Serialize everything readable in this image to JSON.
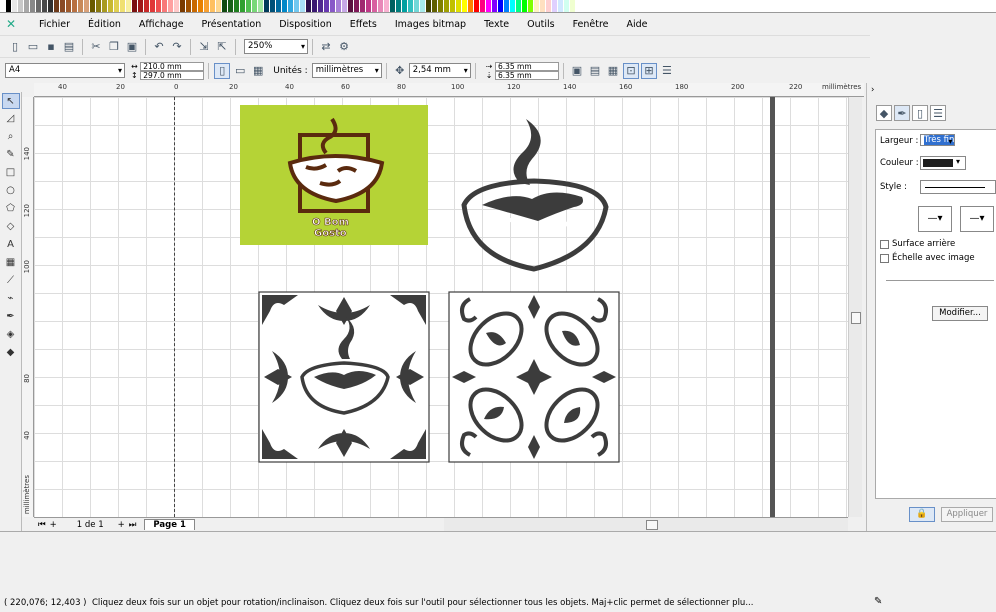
{
  "palette": [
    "#ffffff",
    "#000000",
    "#e8e8e8",
    "#c8c8c8",
    "#a8a8a8",
    "#888888",
    "#686868",
    "#484848",
    "#303030",
    "#6d3a1a",
    "#8a4a25",
    "#a05a2c",
    "#b87040",
    "#c88a5a",
    "#d8a078",
    "#6a5a00",
    "#8a7a10",
    "#a89a20",
    "#c8b830",
    "#e0d050",
    "#f0e070",
    "#f8f0a0",
    "#7a1010",
    "#a01818",
    "#c82828",
    "#e03838",
    "#f05050",
    "#f87878",
    "#ffa0a0",
    "#ffc8c8",
    "#7a3a00",
    "#a05000",
    "#c86800",
    "#e88000",
    "#f8a030",
    "#ffc060",
    "#ffd890",
    "#104a10",
    "#186018",
    "#208020",
    "#30a030",
    "#50c050",
    "#78d878",
    "#a0e8a0",
    "#003a5a",
    "#005078",
    "#006aa0",
    "#0088c8",
    "#30a8e0",
    "#70c8f0",
    "#a8e0f8",
    "#2a1050",
    "#3a1870",
    "#502890",
    "#6838b0",
    "#8858c8",
    "#a880d8",
    "#c8a8e8",
    "#5a1040",
    "#801858",
    "#a02870",
    "#c03888",
    "#d860a0",
    "#e888b8",
    "#f8b0d0",
    "#006060",
    "#008080",
    "#00a0a0",
    "#30c0c0",
    "#70d8d8",
    "#a8ecec",
    "#404000",
    "#606000",
    "#808000",
    "#a0a000",
    "#c0c000",
    "#e0e000",
    "#ffff00",
    "#ff8000",
    "#ff0000",
    "#ff0080",
    "#ff00ff",
    "#8000ff",
    "#0000ff",
    "#0080ff",
    "#00ffff",
    "#00ff80",
    "#00ff00",
    "#80ff00",
    "#fff4c0",
    "#ffe0c0",
    "#ffd0d0",
    "#e0d0ff",
    "#d0e8ff",
    "#d0fff0",
    "#f0ffd0"
  ],
  "menu": [
    "Fichier",
    "Édition",
    "Affichage",
    "Présentation",
    "Disposition",
    "Effets",
    "Images bitmap",
    "Texte",
    "Outils",
    "Fenêtre",
    "Aide"
  ],
  "toolbar": {
    "zoom": "250%"
  },
  "props": {
    "paper": "A4",
    "width": "210.0 mm",
    "height": "297.0 mm",
    "units_label": "Unités :",
    "units_value": "millimètres",
    "nudge": "2,54 mm",
    "dup_x": "6.35 mm",
    "dup_y": "6.35 mm"
  },
  "rulers": {
    "h": [
      "40",
      "20",
      "0",
      "20",
      "40",
      "60",
      "80",
      "100",
      "120",
      "140",
      "160",
      "180",
      "200",
      "220"
    ],
    "h_unit": "millimètres",
    "v": [
      "140",
      "120",
      "100",
      "80",
      "60",
      "40"
    ],
    "v_unit": "millimètres"
  },
  "artwork": {
    "logo_line1": "O Bom",
    "logo_line2": "Gosto"
  },
  "pagebar": {
    "count": "1 de 1",
    "tab": "Page 1"
  },
  "docker": {
    "largeur_label": "Largeur :",
    "largeur_value": "Très fin",
    "couleur_label": "Couleur :",
    "couleur_value": "#1e1e1e",
    "style_label": "Style :",
    "surface_label": "Surface arrière",
    "echelle_label": "Échelle avec image",
    "modifier": "Modifier...",
    "appliquer": "Appliquer"
  },
  "status": {
    "coords": "( 220,076; 12,403 )",
    "message": "Cliquez deux fois sur un objet pour rotation/inclinaison. Cliquez deux fois sur l'outil pour sélectionner tous les objets. Maj+clic permet de sélectionner plu..."
  },
  "colors": {
    "logo_bg": "#b5d336",
    "ink": "#3c3c3c"
  }
}
